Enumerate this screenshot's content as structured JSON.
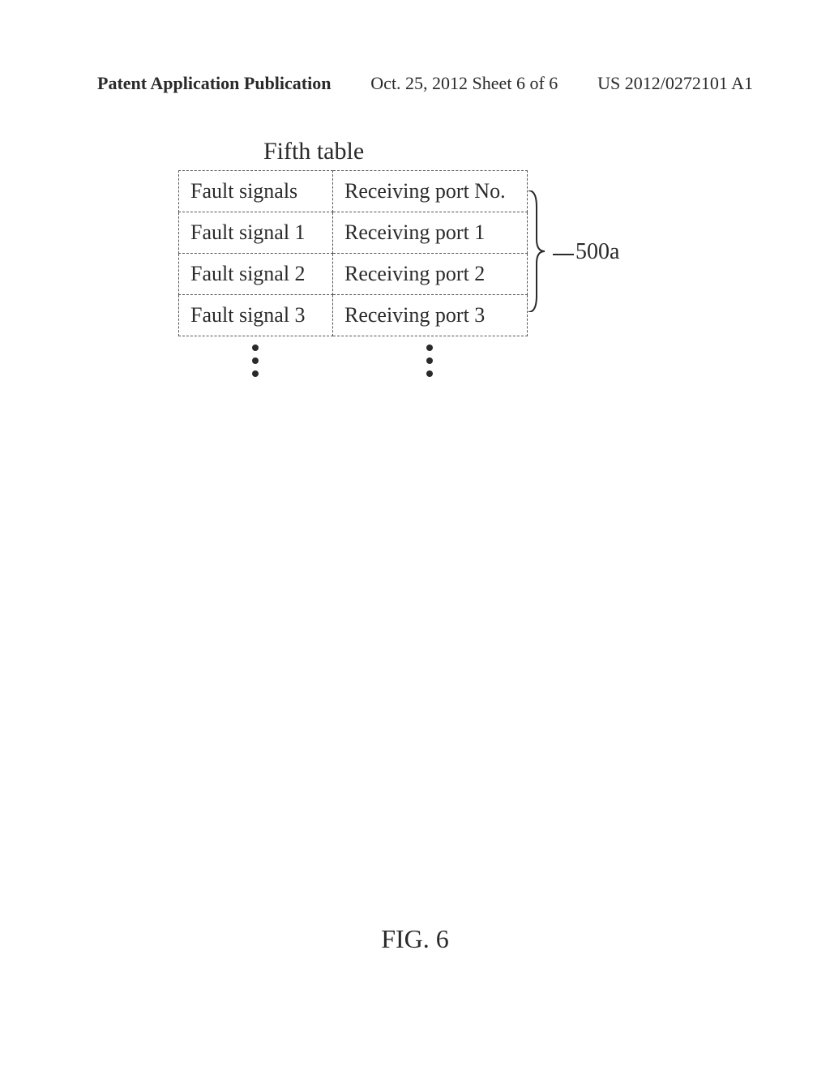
{
  "header": {
    "left": "Patent Application Publication",
    "center": "Oct. 25, 2012  Sheet 6 of 6",
    "right": "US 2012/0272101 A1"
  },
  "table": {
    "title": "Fifth table",
    "headers": {
      "col1": "Fault signals",
      "col2": "Receiving port No."
    },
    "rows": [
      {
        "col1": "Fault signal 1",
        "col2": "Receiving port 1"
      },
      {
        "col1": "Fault signal 2",
        "col2": "Receiving port 2"
      },
      {
        "col1": "Fault signal 3",
        "col2": "Receiving port 3"
      }
    ]
  },
  "reference_label": "500a",
  "figure_caption": "FIG. 6",
  "chart_data": {
    "type": "table",
    "title": "Fifth table",
    "columns": [
      "Fault signals",
      "Receiving port No."
    ],
    "rows": [
      [
        "Fault signal 1",
        "Receiving port 1"
      ],
      [
        "Fault signal 2",
        "Receiving port 2"
      ],
      [
        "Fault signal 3",
        "Receiving port 3"
      ]
    ],
    "note": "continuation dots indicate additional rows",
    "reference": "500a"
  }
}
